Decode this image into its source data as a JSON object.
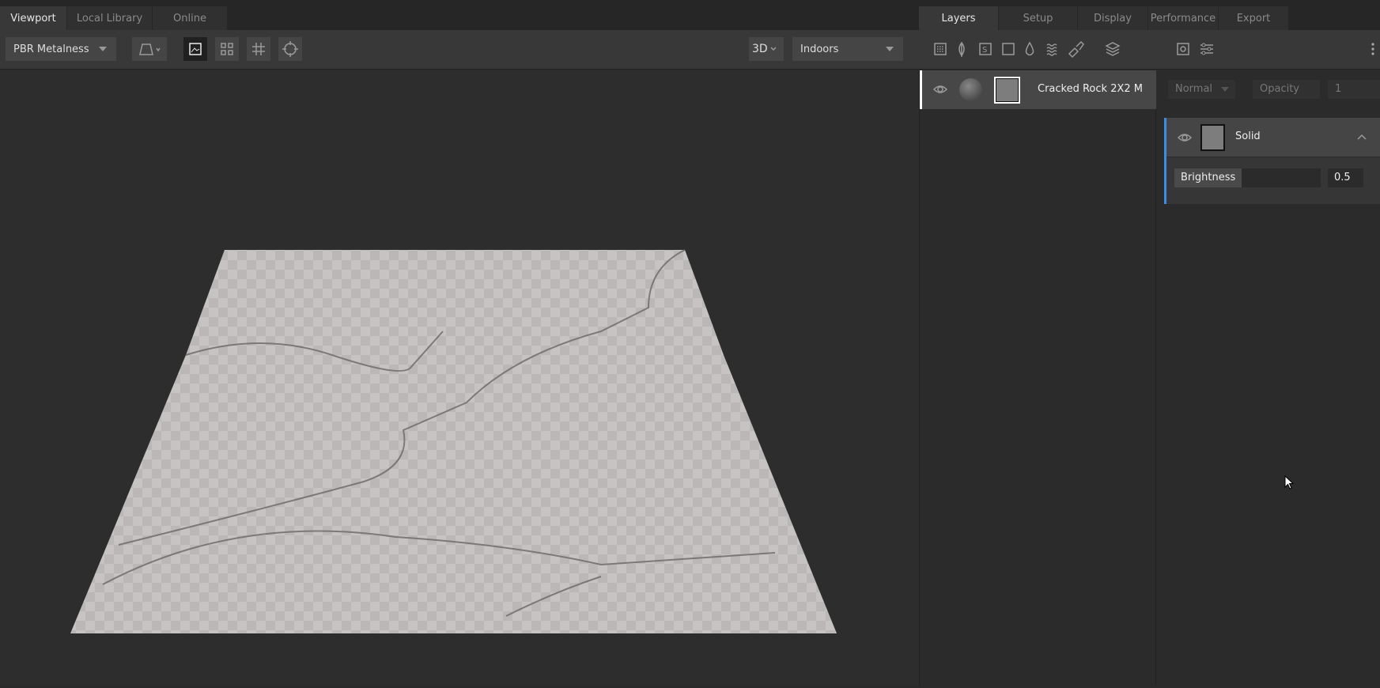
{
  "left_tabs": [
    "Viewport",
    "Local Library",
    "Online"
  ],
  "right_tabs": [
    "Layers",
    "Setup",
    "Display",
    "Performance",
    "Export"
  ],
  "toolbar": {
    "material_model": "PBR Metalness",
    "view_mode": "3D",
    "environment": "Indoors"
  },
  "layers": [
    {
      "name": "Cracked Rock 2X2 M"
    }
  ],
  "properties": {
    "blend_mode": "Normal",
    "opacity_label": "Opacity",
    "opacity_value": "1",
    "solid": {
      "title": "Solid",
      "brightness_label": "Brightness",
      "brightness_value": "0.5",
      "brightness": 0.5
    }
  },
  "colors": {
    "accent": "#3a8ee6"
  }
}
